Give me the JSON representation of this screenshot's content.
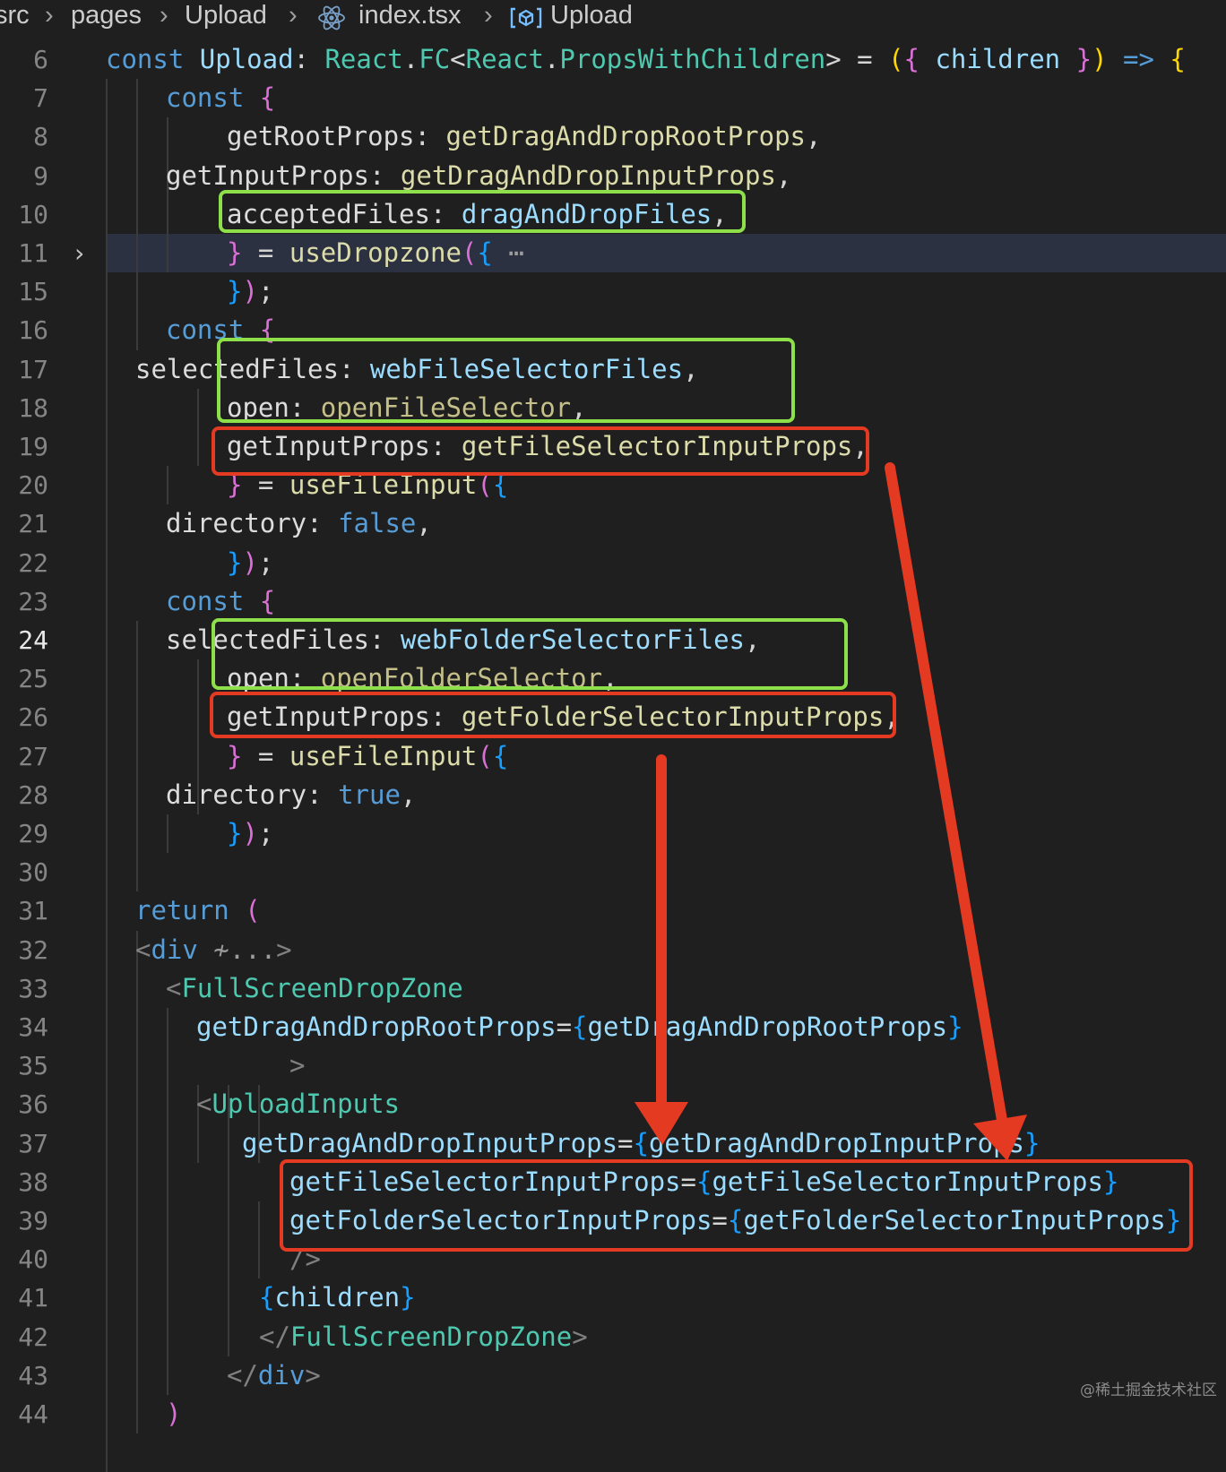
{
  "breadcrumb": {
    "items": [
      {
        "label": "src",
        "icon": null
      },
      {
        "label": "pages",
        "icon": null
      },
      {
        "label": "Upload",
        "icon": null
      },
      {
        "label": "index.tsx",
        "icon": "react-icon"
      },
      {
        "label": "Upload",
        "icon": "symbol-variable-icon"
      }
    ],
    "separator": "›"
  },
  "editor": {
    "active_line": "24",
    "folded_line": "11",
    "lines": [
      {
        "num": "6",
        "tokens": [
          [
            "const",
            "t-keyword"
          ],
          [
            " ",
            "t-plain"
          ],
          [
            "Upload",
            "t-variable"
          ],
          [
            ": ",
            "t-punct"
          ],
          [
            "React",
            "t-type"
          ],
          [
            ".",
            "t-punct"
          ],
          [
            "FC",
            "t-type"
          ],
          [
            "<",
            "t-punct"
          ],
          [
            "React",
            "t-type"
          ],
          [
            ".",
            "t-punct"
          ],
          [
            "PropsWithChildren",
            "t-type"
          ],
          [
            "> = ",
            "t-punct"
          ],
          [
            "(",
            "t-bracket1"
          ],
          [
            "{ ",
            "t-bracket2"
          ],
          [
            "children",
            "t-variable"
          ],
          [
            " }",
            "t-bracket2"
          ],
          [
            ")",
            "t-bracket1"
          ],
          [
            " => ",
            "t-keyword"
          ],
          [
            "{",
            "t-bracket1"
          ]
        ]
      },
      {
        "num": "7",
        "tokens": [
          [
            "const",
            "t-keyword"
          ],
          [
            " {",
            "t-bracket2"
          ]
        ]
      },
      {
        "num": "8",
        "tokens": [
          [
            "getRootProps",
            "t-property"
          ],
          [
            ": ",
            "t-punct"
          ],
          [
            "getDragAndDropRootProps",
            "t-function"
          ],
          [
            ",",
            "t-punct"
          ]
        ]
      },
      {
        "num": "9",
        "tokens": [
          [
            "getInputProps",
            "t-property"
          ],
          [
            ": ",
            "t-punct"
          ],
          [
            "getDragAndDropInputProps",
            "t-function"
          ],
          [
            ",",
            "t-punct"
          ]
        ]
      },
      {
        "num": "10",
        "tokens": [
          [
            "acceptedFiles",
            "t-property"
          ],
          [
            ": ",
            "t-punct"
          ],
          [
            "dragAndDropFiles",
            "t-variable"
          ],
          [
            ",",
            "t-punct"
          ]
        ]
      },
      {
        "num": "11",
        "tokens": [
          [
            "}",
            "t-bracket2"
          ],
          [
            " = ",
            "t-punct"
          ],
          [
            "useDropzone",
            "t-function"
          ],
          [
            "(",
            "t-bracket2"
          ],
          [
            "{",
            "t-bracket3"
          ],
          [
            " ⋯",
            "t-fold"
          ]
        ]
      },
      {
        "num": "15",
        "tokens": [
          [
            "}",
            "t-bracket3"
          ],
          [
            ")",
            "t-bracket2"
          ],
          [
            ";",
            "t-punct"
          ]
        ]
      },
      {
        "num": "16",
        "tokens": [
          [
            "const",
            "t-keyword"
          ],
          [
            " {",
            "t-bracket2"
          ]
        ]
      },
      {
        "num": "17",
        "tokens": [
          [
            "selectedFiles",
            "t-property"
          ],
          [
            ": ",
            "t-punct"
          ],
          [
            "webFileSelectorFiles",
            "t-variable"
          ],
          [
            ",",
            "t-punct"
          ]
        ]
      },
      {
        "num": "18",
        "tokens": [
          [
            "open",
            "t-property"
          ],
          [
            ": ",
            "t-punct"
          ],
          [
            "openFileSelector",
            "t-unused"
          ],
          [
            ",",
            "t-punct"
          ]
        ]
      },
      {
        "num": "19",
        "tokens": [
          [
            "getInputProps",
            "t-property"
          ],
          [
            ": ",
            "t-punct"
          ],
          [
            "getFileSelectorInputProps",
            "t-function"
          ],
          [
            ",",
            "t-punct"
          ]
        ]
      },
      {
        "num": "20",
        "tokens": [
          [
            "}",
            "t-bracket2"
          ],
          [
            " = ",
            "t-punct"
          ],
          [
            "useFileInput",
            "t-function"
          ],
          [
            "(",
            "t-bracket2"
          ],
          [
            "{",
            "t-bracket3"
          ]
        ]
      },
      {
        "num": "21",
        "tokens": [
          [
            "directory",
            "t-property"
          ],
          [
            ": ",
            "t-punct"
          ],
          [
            "false",
            "t-bool"
          ],
          [
            ",",
            "t-punct"
          ]
        ]
      },
      {
        "num": "22",
        "tokens": [
          [
            "}",
            "t-bracket3"
          ],
          [
            ")",
            "t-bracket2"
          ],
          [
            ";",
            "t-punct"
          ]
        ]
      },
      {
        "num": "23",
        "tokens": [
          [
            "const",
            "t-keyword"
          ],
          [
            " {",
            "t-bracket2"
          ]
        ]
      },
      {
        "num": "24",
        "tokens": [
          [
            "selectedFiles",
            "t-property"
          ],
          [
            ": ",
            "t-punct"
          ],
          [
            "webFolderSelectorFiles",
            "t-variable"
          ],
          [
            ",",
            "t-punct"
          ]
        ]
      },
      {
        "num": "25",
        "tokens": [
          [
            "open",
            "t-property"
          ],
          [
            ": ",
            "t-punct"
          ],
          [
            "openFolderSelector",
            "t-unused"
          ],
          [
            ",",
            "t-punct"
          ]
        ]
      },
      {
        "num": "26",
        "tokens": [
          [
            "getInputProps",
            "t-property"
          ],
          [
            ": ",
            "t-punct"
          ],
          [
            "getFolderSelectorInputProps",
            "t-function"
          ],
          [
            ",",
            "t-punct"
          ]
        ]
      },
      {
        "num": "27",
        "tokens": [
          [
            "}",
            "t-bracket2"
          ],
          [
            " = ",
            "t-punct"
          ],
          [
            "useFileInput",
            "t-function"
          ],
          [
            "(",
            "t-bracket2"
          ],
          [
            "{",
            "t-bracket3"
          ]
        ]
      },
      {
        "num": "28",
        "tokens": [
          [
            "directory",
            "t-property"
          ],
          [
            ": ",
            "t-punct"
          ],
          [
            "true",
            "t-bool"
          ],
          [
            ",",
            "t-punct"
          ]
        ]
      },
      {
        "num": "29",
        "tokens": [
          [
            "}",
            "t-bracket3"
          ],
          [
            ")",
            "t-bracket2"
          ],
          [
            ";",
            "t-punct"
          ]
        ]
      },
      {
        "num": "30",
        "tokens": []
      },
      {
        "num": "31",
        "tokens": [
          [
            "return",
            "t-keyword"
          ],
          [
            " (",
            "t-bracket2"
          ]
        ]
      },
      {
        "num": "32",
        "tokens": [
          [
            "<",
            "t-tag"
          ],
          [
            "div",
            "t-keyword"
          ],
          [
            " ≁...",
            "t-fold"
          ],
          [
            ">",
            "t-tag"
          ]
        ]
      },
      {
        "num": "33",
        "tokens": [
          [
            "<",
            "t-tag"
          ],
          [
            "FullScreenDropZone",
            "t-component"
          ]
        ]
      },
      {
        "num": "34",
        "tokens": [
          [
            "getDragAndDropRootProps",
            "t-attr"
          ],
          [
            "=",
            "t-punct"
          ],
          [
            "{",
            "t-bracket3"
          ],
          [
            "getDragAndDropRootProps",
            "t-variable"
          ],
          [
            "}",
            "t-bracket3"
          ]
        ]
      },
      {
        "num": "35",
        "tokens": [
          [
            ">",
            "t-tag"
          ]
        ]
      },
      {
        "num": "36",
        "tokens": [
          [
            "<",
            "t-tag"
          ],
          [
            "UploadInputs",
            "t-component"
          ]
        ]
      },
      {
        "num": "37",
        "tokens": [
          [
            "getDragAndDropInputProps",
            "t-attr"
          ],
          [
            "=",
            "t-punct"
          ],
          [
            "{",
            "t-bracket3"
          ],
          [
            "getDragAndDropInputProps",
            "t-variable"
          ],
          [
            "}",
            "t-bracket3"
          ]
        ]
      },
      {
        "num": "38",
        "tokens": [
          [
            "getFileSelectorInputProps",
            "t-attr"
          ],
          [
            "=",
            "t-punct"
          ],
          [
            "{",
            "t-bracket3"
          ],
          [
            "getFileSelectorInputProps",
            "t-variable"
          ],
          [
            "}",
            "t-bracket3"
          ]
        ]
      },
      {
        "num": "39",
        "tokens": [
          [
            "getFolderSelectorInputProps",
            "t-attr"
          ],
          [
            "=",
            "t-punct"
          ],
          [
            "{",
            "t-bracket3"
          ],
          [
            "getFolderSelectorInputProps",
            "t-variable"
          ],
          [
            "}",
            "t-bracket3"
          ]
        ]
      },
      {
        "num": "40",
        "tokens": [
          [
            "/>",
            "t-tag"
          ]
        ]
      },
      {
        "num": "41",
        "tokens": [
          [
            "{",
            "t-bracket3"
          ],
          [
            "children",
            "t-variable"
          ],
          [
            "}",
            "t-bracket3"
          ]
        ]
      },
      {
        "num": "42",
        "tokens": [
          [
            "</",
            "t-tag"
          ],
          [
            "FullScreenDropZone",
            "t-component"
          ],
          [
            ">",
            "t-tag"
          ]
        ]
      },
      {
        "num": "43",
        "tokens": [
          [
            "</",
            "t-tag"
          ],
          [
            "div",
            "t-keyword"
          ],
          [
            ">",
            "t-tag"
          ]
        ]
      },
      {
        "num": "44",
        "tokens": [
          [
            ")",
            "t-bracket2"
          ]
        ]
      }
    ]
  },
  "annotations": {
    "box_colors": {
      "green": "#8ee04a",
      "red": "#e53a22"
    },
    "arrow_color": "#e53a22"
  },
  "watermark": "@稀土掘金技术社区"
}
